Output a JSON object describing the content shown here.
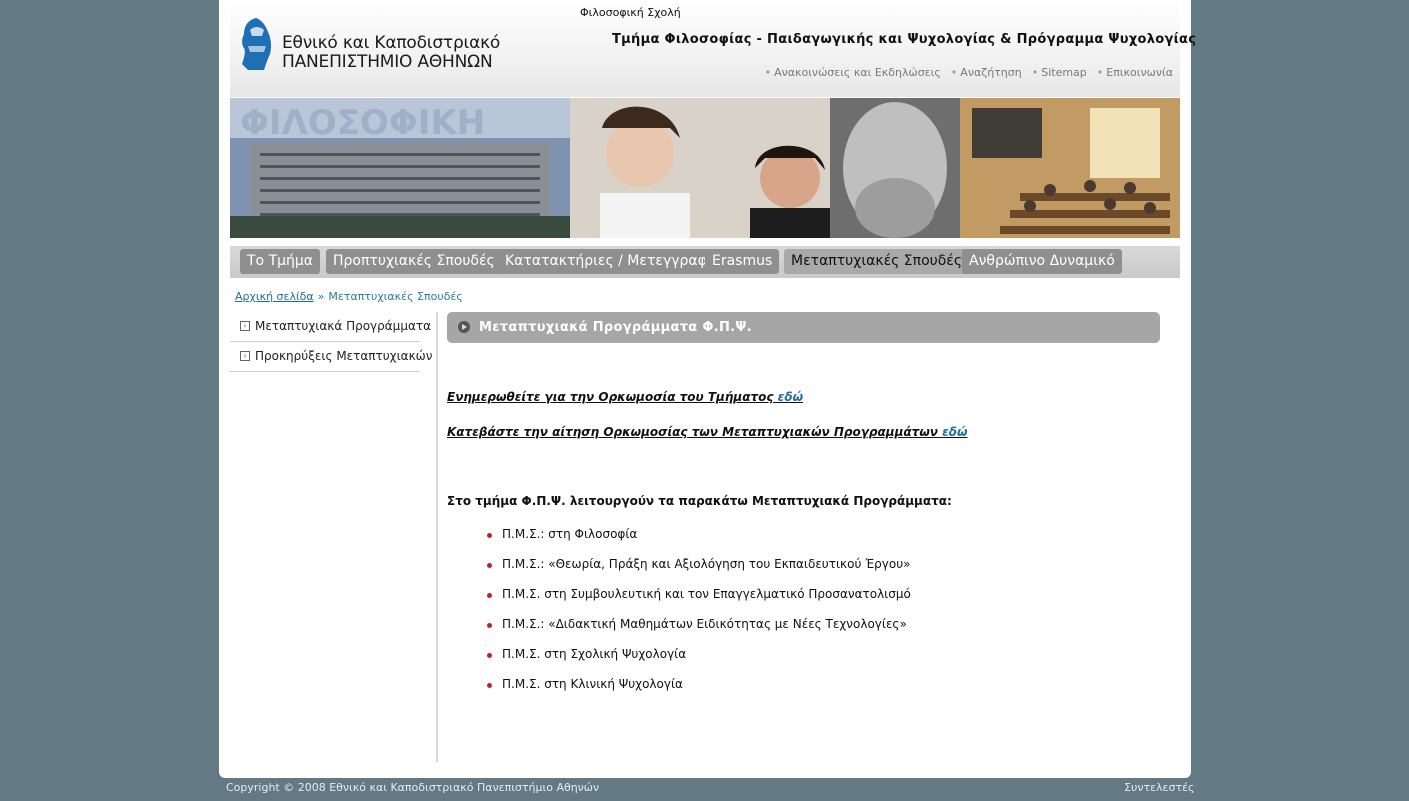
{
  "header": {
    "logo_line1": "Εθνικό και Καποδιστριακό",
    "logo_line2": "ΠΑΝΕΠΙΣΤΗΜΙΟ ΑΘΗΝΩΝ",
    "school": "Φιλοσοφική Σχολή",
    "department": "Τμήμα Φιλοσοφίας - Παιδαγωγικής και Ψυχολογίας & Πρόγραμμα Ψυχολογίας",
    "links": [
      "Ανακοινώσεις και Εκδηλώσεις",
      "Αναζήτηση",
      "Sitemap",
      "Επικοινωνία"
    ]
  },
  "banner": {
    "text": "ΦΙΛΟΣΟΦΙΚΗ"
  },
  "nav": {
    "items": [
      "Το Τμήμα",
      "Προπτυχιακές Σπουδές",
      "Κατατακτήριες / Μετεγγραφές",
      "Erasmus",
      "Μεταπτυχιακές Σπουδές",
      "Ανθρώπινο Δυναμικό"
    ],
    "active_index": 4
  },
  "breadcrumb": {
    "home": "Αρχική σελίδα",
    "separator": "»",
    "current": "Μεταπτυχιακές Σπουδές"
  },
  "sidebar": {
    "items": [
      "Μεταπτυχιακά Προγράμματα",
      "Προκηρύξεις Μεταπτυχιακών"
    ]
  },
  "main": {
    "title": "Μεταπτυχιακά Προγράμματα Φ.Π.Ψ.",
    "notice1_text": "Ενημερωθείτε για την Ορκωμοσία του Τμήματος",
    "notice1_link": "εδώ",
    "notice2_text": "Κατεβάστε την αίτηση Ορκωμοσίας των Μεταπτυχιακών Προγραμμάτων",
    "notice2_link": "εδώ",
    "intro": "Στο τμήμα Φ.Π.Ψ. λειτουργούν τα παρακάτω Μεταπτυχιακά Προγράμματα:",
    "programs": [
      "Π.Μ.Σ.: στη Φιλοσοφία",
      "Π.Μ.Σ.: «Θεωρία, Πράξη και Αξιολόγηση του Εκπαιδευτικού Έργου»",
      "Π.Μ.Σ. στη Συμβουλευτική και τον Επαγγελματικό Προσανατολισμό",
      "Π.Μ.Σ.: «Διδακτική Μαθημάτων Ειδικότητας με Νέες Τεχνολογίες»",
      "Π.Μ.Σ. στη Σχολική Ψυχολογία",
      "Π.Μ.Σ. στη Κλινική Ψυχολογία"
    ]
  },
  "footer": {
    "copyright": "Copyright © 2008 Εθνικό και Καποδιστριακό Πανεπιστήμιο Αθηνών",
    "credits": "Συντελεστές"
  },
  "colors": {
    "background": "#637a85",
    "nav_button": "#8f8f8f",
    "title_bar": "#a6a6a6",
    "link": "#1f6e9c",
    "bullet": "#c0202a"
  }
}
